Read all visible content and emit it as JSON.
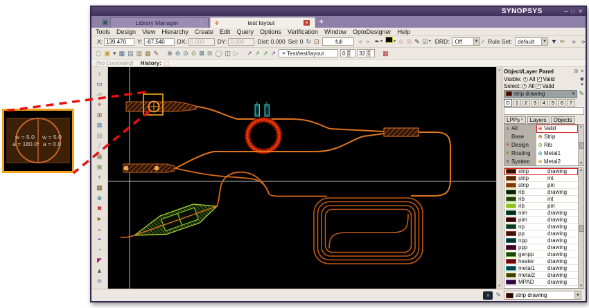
{
  "window": {
    "brand": "SYNOPSYS",
    "minimize": "─",
    "maximize": "□",
    "close": "✕"
  },
  "tabs": {
    "home_icon": "⌂",
    "library_icon": "▣",
    "items": [
      {
        "label": "Library Manager"
      },
      {
        "label": "test layout"
      }
    ],
    "close_glyph": "✕",
    "active_icon": "✛",
    "new_tab": "+"
  },
  "menu": {
    "items": [
      "Tools",
      "Design",
      "View",
      "Hierarchy",
      "Create",
      "Edit",
      "Query",
      "Options",
      "Verification",
      "Window",
      "OptoDesigner",
      "Help"
    ]
  },
  "toolbar1": {
    "fields": [
      {
        "label": "X:",
        "value": "139.470",
        "enabled": true
      },
      {
        "label": "Y:",
        "value": "-87.540",
        "enabled": true
      },
      {
        "label": "DX:",
        "value": "0.000",
        "enabled": false
      },
      {
        "label": "DY:",
        "value": "0.000",
        "enabled": false
      }
    ],
    "dist_label": "Dist:",
    "dist_value": "0.000",
    "sel_label": "Sel: 0",
    "view_combo": "full",
    "drd_label": "DRD:",
    "drd_combo": "Off",
    "ruleset_label": "Rule Set:",
    "ruleset_combo": "default",
    "overflow_glyph": "»",
    "icons_a": [
      {
        "name": "refresh-view-icon",
        "glyph": "↻",
        "color": "#356a9a"
      },
      {
        "name": "select-box-icon",
        "glyph": "⊡",
        "color": "#6a4a2a"
      }
    ],
    "icons_b": [
      {
        "name": "view-prev-icon",
        "glyph": "◄",
        "color": "#c2bdb4"
      },
      {
        "name": "view-next-icon",
        "glyph": "►",
        "color": "#c2bdb4"
      }
    ],
    "icons_c": [
      {
        "name": "stylus-tool-icon",
        "glyph": "✒",
        "color": "#2a2a3a",
        "dropdown": true
      },
      {
        "name": "active-layer-swatch",
        "swatch": "#000000",
        "border": "#cccc22",
        "dropdown": true
      },
      {
        "name": "clear-highlight-icon",
        "glyph": "⊗",
        "color": "#d9a8a8"
      },
      {
        "name": "zoom-selected-icon",
        "glyph": "⊠",
        "color": "#d9a8a8"
      },
      {
        "name": "edit-pen-icon",
        "glyph": "✎",
        "color": "#333333"
      }
    ],
    "icons_d": [
      {
        "name": "drd-check-icon",
        "glyph": "☑",
        "color": "#2a5a2a",
        "dropdown": true
      }
    ],
    "icons_e": [
      {
        "name": "drd-edit-icon",
        "glyph": "∕",
        "color": "#334a8a"
      }
    ],
    "icons_f": [
      {
        "name": "filter-funnel-icon",
        "glyph": "▼",
        "color": "#2a3a5a"
      },
      {
        "name": "brush-icon",
        "glyph": "✏",
        "color": "#8a6a2a"
      }
    ]
  },
  "toolbar2": {
    "cell_field": "Test/test/layout",
    "cell_icon": "➜",
    "level_min": "0",
    "level_max": "32",
    "icons_file": [
      {
        "name": "new-file-icon",
        "glyph": "▢",
        "color": "#8a8a7a"
      },
      {
        "name": "open-file-icon",
        "glyph": "▣",
        "color": "#c09a30"
      },
      {
        "name": "open-dropdown-icon",
        "glyph": "▾",
        "color": "#555555"
      },
      {
        "name": "save-icon",
        "glyph": "▦",
        "color": "#4a6a9a"
      },
      {
        "name": "print-icon",
        "glyph": "▤",
        "color": "#667788"
      },
      {
        "name": "capture-icon",
        "glyph": "▥",
        "color": "#8a7744"
      },
      {
        "name": "table-icon",
        "glyph": "▦",
        "color": "#9a7a3a"
      },
      {
        "name": "help-pen-icon",
        "glyph": "✎",
        "color": "#8a3a3a"
      }
    ],
    "icons_zoom": [
      {
        "name": "zoom-in-icon",
        "glyph": "⊕",
        "color": "#35607a"
      },
      {
        "name": "zoom-out-icon",
        "glyph": "⊖",
        "color": "#35607a"
      },
      {
        "name": "zoom-window-icon",
        "glyph": "⊙",
        "color": "#35607a"
      },
      {
        "name": "zoom-fit-icon",
        "glyph": "⊙",
        "color": "#6a7a35"
      },
      {
        "name": "zoom-selection-icon",
        "glyph": "⊠",
        "color": "#35607a"
      },
      {
        "name": "zoom-prev-icon",
        "glyph": "⊠",
        "color": "#888888"
      },
      {
        "name": "redraw-icon",
        "glyph": "◯",
        "color": "#888888"
      },
      {
        "name": "pan-view-icon",
        "glyph": "◫",
        "color": "#555577"
      },
      {
        "name": "play-icon",
        "glyph": "▷",
        "color": "#888899"
      }
    ],
    "icons_hier": [
      {
        "name": "descend-hierarchy-icon",
        "glyph": "↗",
        "color": "#7a3a9a"
      },
      {
        "name": "ascend-hierarchy-icon",
        "glyph": "↗",
        "color": "#3a8a3a"
      },
      {
        "name": "edit-in-place-icon",
        "glyph": "↗",
        "color": "#3a8a3a"
      },
      {
        "name": "return-hierarchy-icon",
        "glyph": "↗",
        "color": "#7a3a9a"
      }
    ],
    "grid_icon": {
      "name": "grid-icon",
      "glyph": "▦",
      "color": "#aa3333"
    }
  },
  "command": {
    "prompt": "(No Command)",
    "history_label": "History:",
    "history_icon": "⬚"
  },
  "left_tools": {
    "icons": [
      {
        "name": "note-tool-icon",
        "glyph": "♪",
        "color": "#8a4a9a"
      },
      {
        "name": "rect-tool-icon",
        "glyph": "▭",
        "color": "#3a5a8a"
      },
      {
        "name": "clone-tool-icon",
        "glyph": "▱",
        "color": "#3a8a5a"
      },
      {
        "name": "pin-tool-icon",
        "glyph": "⌖",
        "color": "#aa3333"
      },
      {
        "name": "array-tool-icon",
        "glyph": "⊞",
        "color": "#aa5522"
      },
      {
        "name": "close-shape-tool-icon",
        "glyph": "⊠",
        "color": "#3a6a9a"
      },
      {
        "name": "flatten-tool-icon",
        "glyph": "⊟",
        "color": "#777777"
      },
      {
        "name": "slash-tool-icon",
        "glyph": "╱",
        "color": "#999999"
      },
      {
        "name": "copy-tool-icon",
        "glyph": "▣",
        "color": "#8a8a66"
      },
      {
        "name": "paste-tool-icon",
        "glyph": "▣",
        "color": "#88aa66"
      },
      {
        "name": "add-tool-icon",
        "glyph": "+",
        "color": "#3a8a3a"
      },
      {
        "name": "fill-tool-icon",
        "glyph": "▦",
        "color": "#7a5a2a"
      },
      {
        "name": "merge-tool-icon",
        "glyph": "⊕",
        "color": "#2a7a9a"
      },
      {
        "name": "delete-tool-icon",
        "glyph": "✖",
        "color": "#cc2222"
      },
      {
        "name": "route-tool-icon",
        "glyph": "►",
        "color": "#8a6a1a"
      },
      {
        "name": "measure-tool-icon",
        "glyph": "◒",
        "color": "#aa7722"
      },
      {
        "name": "text-tool-icon",
        "glyph": "◓",
        "color": "#7722aa"
      },
      {
        "name": "via-tool-icon",
        "glyph": "◔",
        "color": "#22aa77"
      },
      {
        "name": "corner-tool-icon",
        "glyph": "◤",
        "color": "#aa2277"
      },
      {
        "name": "up-tool-icon",
        "glyph": "▲",
        "color": "#555566"
      },
      {
        "name": "layers-tool-icon",
        "glyph": "≋",
        "color": "#666699"
      }
    ]
  },
  "callout": {
    "left_w": "w = 5.0",
    "left_a": "a = 180.0",
    "right_w": "w = 5.0",
    "right_a": "a = 0.0"
  },
  "panel": {
    "title": "Object/Layer Panel",
    "dock_icon": "⊞",
    "close_icon": "✕",
    "visible_label": "Visible:",
    "select_label": "Select:",
    "all_label": "All",
    "valid_label": "Valid",
    "radio_glyph": "•",
    "check_glyph": "✓",
    "rail_icons": [
      {
        "name": "panel-refresh-icon",
        "glyph": "◉"
      },
      {
        "name": "panel-rail-dropdown-icon",
        "glyph": "▾"
      }
    ],
    "layer_combo": "strip drawing",
    "palette_icon": "✎",
    "d_buttons": [
      "D",
      "1",
      "2",
      "3",
      "4",
      "5",
      "6",
      "7"
    ],
    "tabs": [
      "LPPs",
      "Layers",
      "Objects"
    ],
    "groups_left": [
      {
        "label": "All",
        "glyph": "∧",
        "color": "#444444"
      },
      {
        "label": "Base",
        "glyph": "",
        "color": "#444444"
      },
      {
        "label": "Design",
        "glyph": "⊕",
        "color": "#cc5510"
      },
      {
        "label": "Routing",
        "glyph": "⊕",
        "color": "#8a8a20"
      },
      {
        "label": "System",
        "glyph": "∧",
        "color": "#333333"
      }
    ],
    "groups_right": [
      {
        "label": "Valid",
        "color": "#cc3300",
        "highlight": true
      },
      {
        "label": "Strip",
        "color": "#b05010"
      },
      {
        "label": "Rib",
        "color": "#66aa22"
      },
      {
        "label": "Metal1",
        "color": "#2299aa"
      },
      {
        "label": "Metal2",
        "color": "#cc9910"
      }
    ],
    "layers": [
      {
        "name": "strip",
        "purpose": "drawing",
        "fill": "#2a1004",
        "border": "#9a4410",
        "highlight": true
      },
      {
        "name": "strip",
        "purpose": "int",
        "fill": "#54280c",
        "border": "#a85a14"
      },
      {
        "name": "strip",
        "purpose": "pin",
        "fill": "#7a3c0e",
        "border": "#d2691e"
      },
      {
        "name": "rib",
        "purpose": "drawing",
        "fill": "#0d1f06",
        "border": "#4a7a1a"
      },
      {
        "name": "rib",
        "purpose": "int",
        "fill": "#23400e",
        "border": "#6a9a22"
      },
      {
        "name": "rib",
        "purpose": "pin",
        "fill": "#8fbf2a",
        "border": "#b8e040"
      },
      {
        "name": "nim",
        "purpose": "drawing",
        "fill": "#06281a",
        "border": "#1a6a4a"
      },
      {
        "name": "pim",
        "purpose": "drawing",
        "fill": "#2d0909",
        "border": "#7a2020"
      },
      {
        "name": "np",
        "purpose": "drawing",
        "fill": "#15352a",
        "border": "#3a7a4a"
      },
      {
        "name": "pp",
        "purpose": "drawing",
        "fill": "#3d140c",
        "border": "#95301a"
      },
      {
        "name": "npp",
        "purpose": "drawing",
        "fill": "#062e2e",
        "border": "#1a7a7a"
      },
      {
        "name": "ppp",
        "purpose": "drawing",
        "fill": "#30081c",
        "border": "#7a2050"
      },
      {
        "name": "genpp",
        "purpose": "drawing",
        "fill": "#1e4410",
        "border": "#55aa22"
      },
      {
        "name": "heater",
        "purpose": "drawing",
        "fill": "#5a1010",
        "border": "#cc3030"
      },
      {
        "name": "metal1",
        "purpose": "drawing",
        "fill": "#083e42",
        "border": "#22aab0"
      },
      {
        "name": "metal2",
        "purpose": "drawing",
        "fill": "#3e3e0c",
        "border": "#aaa820"
      },
      {
        "name": "MPAD",
        "purpose": "drawing",
        "fill": "#270b30",
        "border": "#7a30a0"
      }
    ]
  },
  "status": {
    "console_glyph": "»",
    "spline_glyph": "✎",
    "layer_combo": "strip drawing"
  }
}
